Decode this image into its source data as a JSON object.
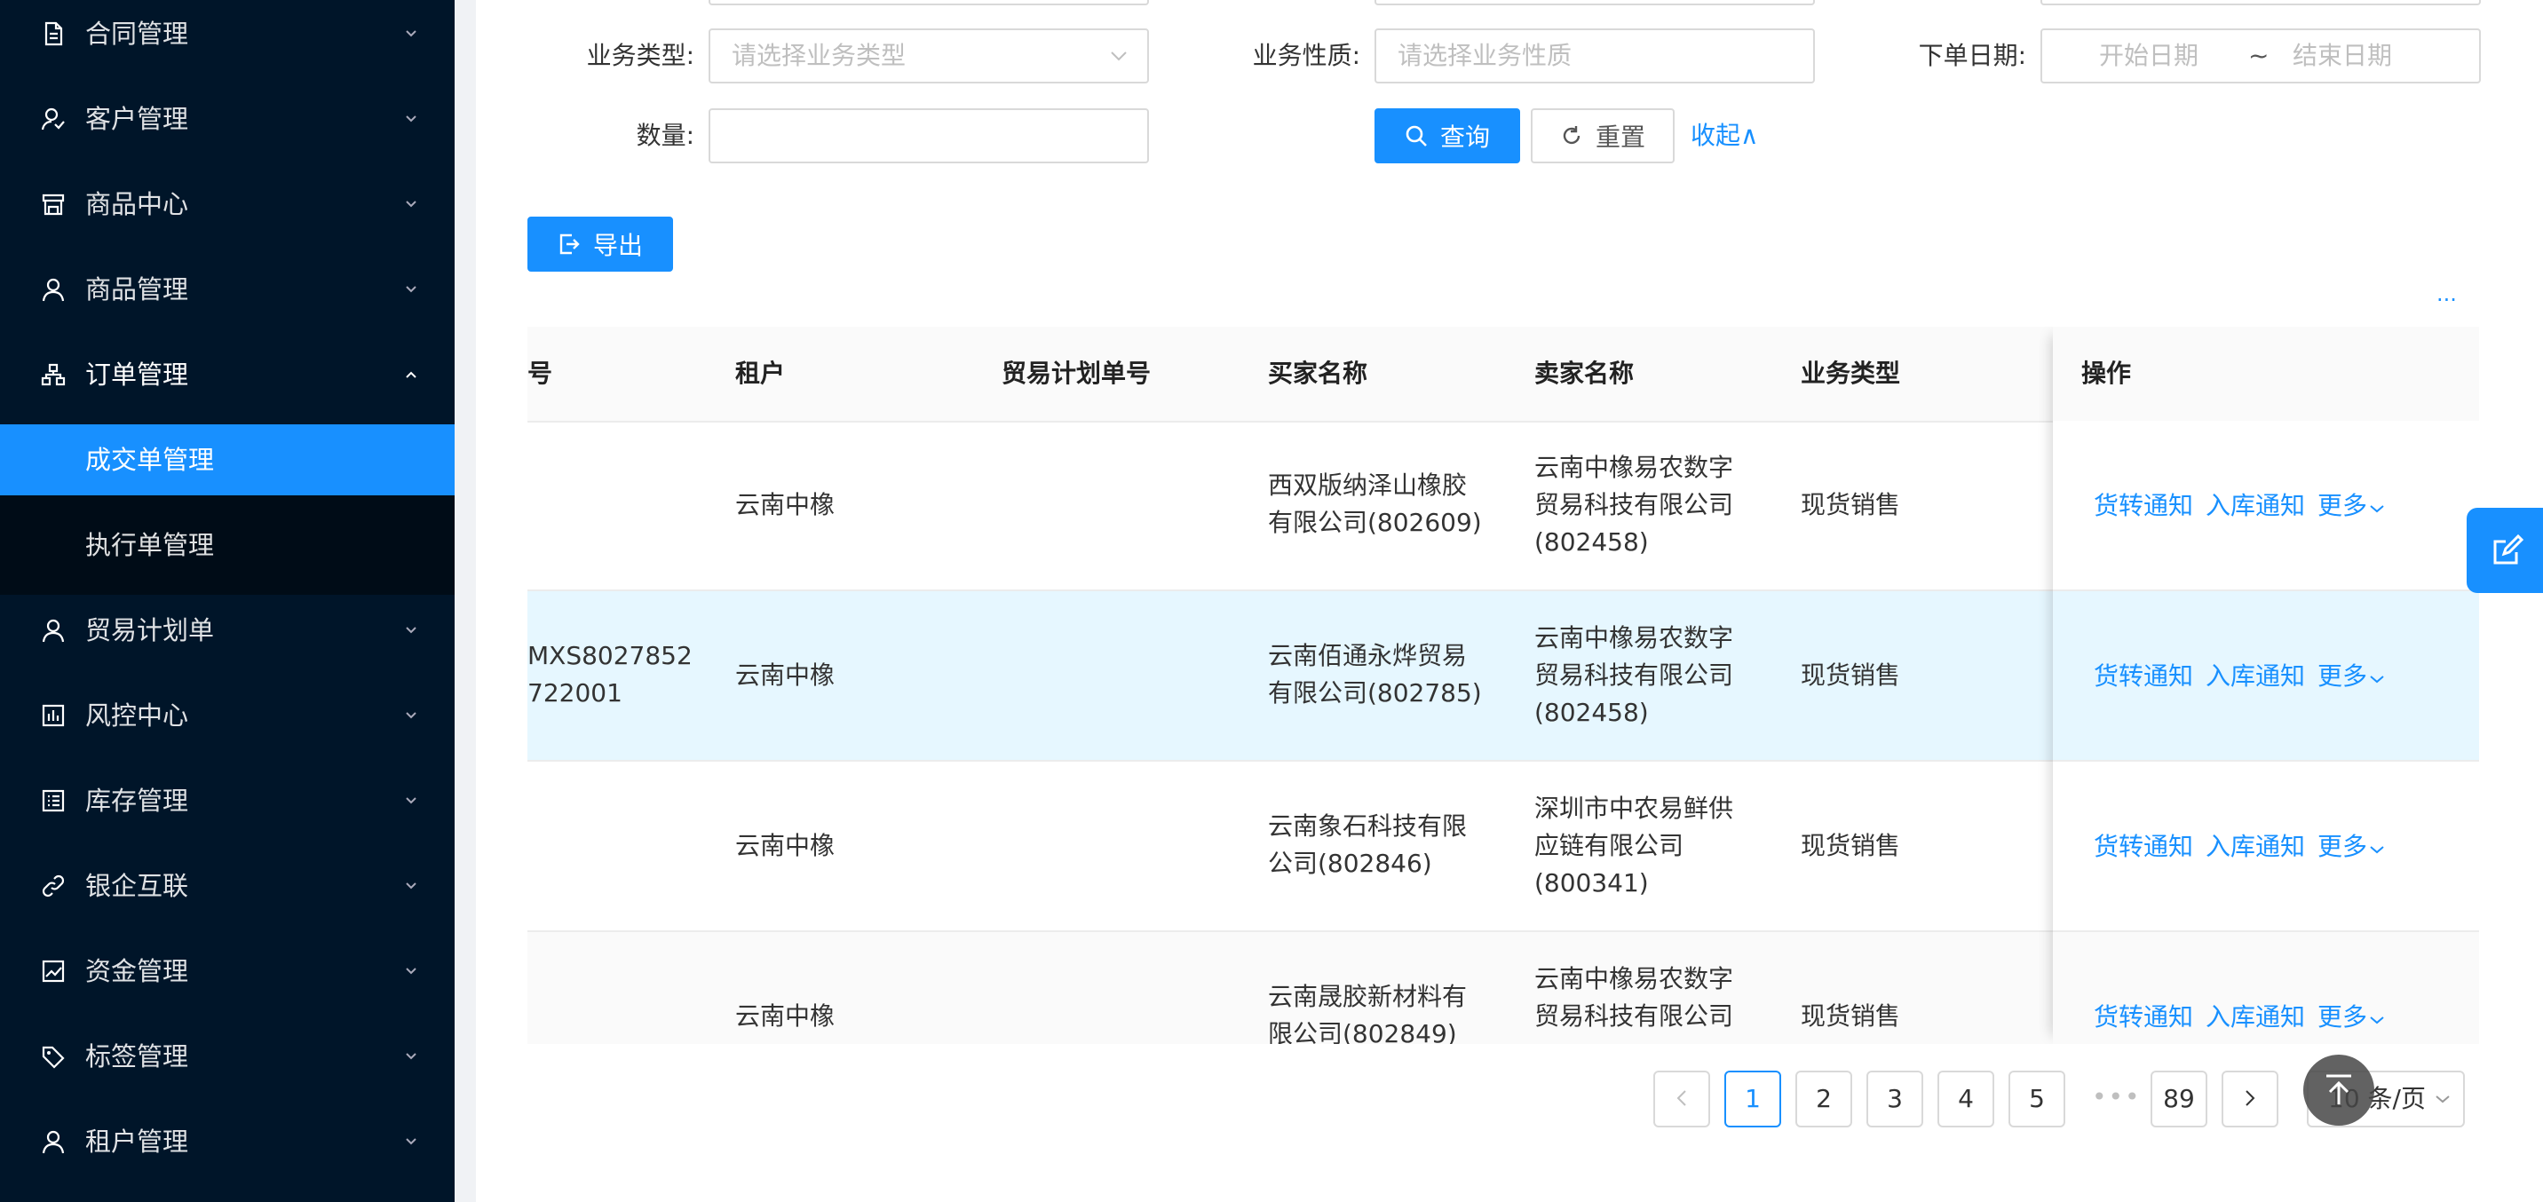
{
  "sidebar": {
    "items": [
      {
        "label": "合同管理",
        "icon": "document-icon"
      },
      {
        "label": "客户管理",
        "icon": "users-icon"
      },
      {
        "label": "商品中心",
        "icon": "store-icon"
      },
      {
        "label": "商品管理",
        "icon": "user-icon"
      },
      {
        "label": "订单管理",
        "icon": "hierarchy-icon"
      },
      {
        "label": "贸易计划单",
        "icon": "user-icon"
      },
      {
        "label": "风控中心",
        "icon": "risk-icon"
      },
      {
        "label": "库存管理",
        "icon": "list-icon"
      },
      {
        "label": "银企互联",
        "icon": "link-icon"
      },
      {
        "label": "资金管理",
        "icon": "chart-line-icon"
      },
      {
        "label": "标签管理",
        "icon": "tag-icon"
      },
      {
        "label": "租户管理",
        "icon": "user-icon"
      }
    ],
    "submenu": [
      {
        "label": "成交单管理",
        "active": true
      },
      {
        "label": "执行单管理",
        "active": false
      }
    ]
  },
  "filters": {
    "business_type_label": "业务类型:",
    "business_type_placeholder": "请选择业务类型",
    "business_nature_label": "业务性质:",
    "business_nature_placeholder": "请选择业务性质",
    "order_date_label": "下单日期:",
    "start_date_placeholder": "开始日期",
    "date_separator": "~",
    "end_date_placeholder": "结束日期",
    "quantity_label": "数量:",
    "query_button": "查询",
    "reset_button": "重置",
    "collapse_link": "收起∧"
  },
  "toolbar": {
    "export_button": "导出",
    "more_dots": "···"
  },
  "table": {
    "columns": [
      "号",
      "租户",
      "贸易计划单号",
      "买家名称",
      "卖家名称",
      "业务类型",
      "操作"
    ],
    "rows": [
      {
        "no_line1": "",
        "no_line2": "",
        "tenant": "云南中橡",
        "plan_no": "",
        "buyer_line1": "西双版纳泽山橡胶",
        "buyer_line2": "有限公司(802609)",
        "seller_line1": "云南中橡易农数字",
        "seller_line2": "贸易科技有限公司",
        "seller_line3": "(802458)",
        "biz_type": "现货销售"
      },
      {
        "no_line1": "MXS8027852",
        "no_line2": "722001",
        "tenant": "云南中橡",
        "plan_no": "",
        "buyer_line1": "云南佰通永烨贸易",
        "buyer_line2": "有限公司(802785)",
        "seller_line1": "云南中橡易农数字",
        "seller_line2": "贸易科技有限公司",
        "seller_line3": "(802458)",
        "biz_type": "现货销售"
      },
      {
        "no_line1": "",
        "no_line2": "",
        "tenant": "云南中橡",
        "plan_no": "",
        "buyer_line1": "云南象石科技有限",
        "buyer_line2": "公司(802846)",
        "seller_line1": "深圳市中农易鲜供",
        "seller_line2": "应链有限公司",
        "seller_line3": "(800341)",
        "biz_type": "现货销售"
      },
      {
        "no_line1": "",
        "no_line2": "",
        "tenant": "云南中橡",
        "plan_no": "",
        "buyer_line1": "云南晟胶新材料有",
        "buyer_line2": "限公司(802849)",
        "seller_line1": "云南中橡易农数字",
        "seller_line2": "贸易科技有限公司",
        "seller_line3": "",
        "biz_type": "现货销售"
      }
    ],
    "actions": {
      "transfer": "货转通知",
      "inbound": "入库通知",
      "more": "更多"
    }
  },
  "pagination": {
    "pages": [
      "1",
      "2",
      "3",
      "4",
      "5"
    ],
    "ellipsis": "•••",
    "last_page": "89",
    "current": "1",
    "page_size": "10 条/页"
  }
}
